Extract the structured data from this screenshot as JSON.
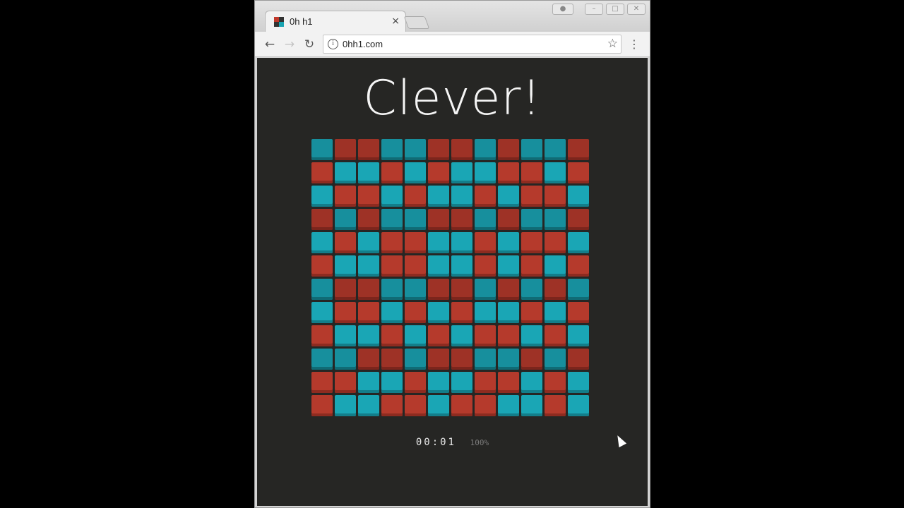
{
  "browser": {
    "tab_title": "0h h1",
    "tab_close": "×",
    "url": "0hh1.com",
    "icons": {
      "back": "arrow-left-icon",
      "forward": "arrow-right-icon",
      "reload": "reload-icon",
      "info": "info-icon",
      "star": "star-icon",
      "menu": "kebab-menu-icon",
      "profile": "profile-icon"
    }
  },
  "game": {
    "headline": "Clever!",
    "timer": "00:01",
    "progress": "100%",
    "colors": {
      "red": "#b53a2c",
      "blue": "#1aa6b5",
      "background": "#262624"
    },
    "grid": [
      [
        "B",
        "R",
        "R",
        "B",
        "B",
        "R",
        "R",
        "B",
        "R",
        "B",
        "B",
        "R"
      ],
      [
        "R",
        "B",
        "B",
        "R",
        "B",
        "R",
        "B",
        "B",
        "R",
        "R",
        "B",
        "R"
      ],
      [
        "B",
        "R",
        "R",
        "B",
        "R",
        "B",
        "B",
        "R",
        "B",
        "R",
        "R",
        "B"
      ],
      [
        "R",
        "B",
        "R",
        "B",
        "B",
        "R",
        "R",
        "B",
        "R",
        "B",
        "B",
        "R"
      ],
      [
        "B",
        "R",
        "B",
        "R",
        "R",
        "B",
        "B",
        "R",
        "B",
        "R",
        "R",
        "B"
      ],
      [
        "R",
        "B",
        "B",
        "R",
        "R",
        "B",
        "B",
        "R",
        "B",
        "R",
        "B",
        "R"
      ],
      [
        "B",
        "R",
        "R",
        "B",
        "B",
        "R",
        "R",
        "B",
        "R",
        "B",
        "R",
        "B"
      ],
      [
        "B",
        "R",
        "R",
        "B",
        "R",
        "B",
        "R",
        "B",
        "B",
        "R",
        "B",
        "R"
      ],
      [
        "R",
        "B",
        "B",
        "R",
        "B",
        "R",
        "B",
        "R",
        "R",
        "B",
        "R",
        "B"
      ],
      [
        "B",
        "B",
        "R",
        "R",
        "B",
        "R",
        "R",
        "B",
        "B",
        "R",
        "B",
        "R"
      ],
      [
        "R",
        "R",
        "B",
        "B",
        "R",
        "B",
        "B",
        "R",
        "R",
        "B",
        "R",
        "B"
      ],
      [
        "R",
        "B",
        "B",
        "R",
        "R",
        "B",
        "R",
        "R",
        "B",
        "B",
        "R",
        "B"
      ]
    ]
  }
}
